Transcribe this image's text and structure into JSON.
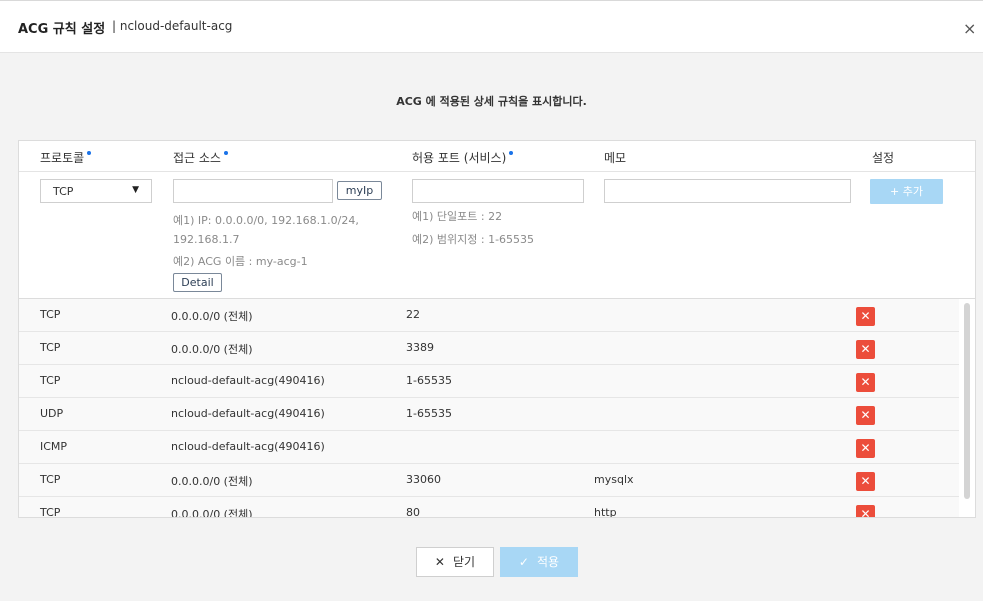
{
  "dialog": {
    "title": "ACG 규칙 설정",
    "subtitle": "| ncloud-default-acg",
    "close_glyph": "×",
    "description": "ACG 에 적용된 상세 규칙을 표시합니다."
  },
  "table": {
    "headers": {
      "protocol": "프로토콜",
      "source": "접근 소스",
      "port": "허용 포트 (서비스)",
      "memo": "메모",
      "setting": "설정"
    },
    "required_color": "#1a73e8"
  },
  "form": {
    "protocol_value": "TCP",
    "source_value": "",
    "port_value": "",
    "memo_value": "",
    "myip_label": "myIp",
    "source_hint1": "예1) IP: 0.0.0.0/0, 192.168.1.0/24,",
    "source_hint1b": "192.168.1.7",
    "source_hint2": "예2) ACG 이름 : my-acg-1",
    "detail_label": "Detail",
    "port_hint1": "예1) 단일포트 : 22",
    "port_hint2": "예2) 범위지정 : 1-65535",
    "add_label": "+ 추가",
    "add_color": "#a8d7f5"
  },
  "rules": [
    {
      "protocol": "TCP",
      "source": "0.0.0.0/0 (전체)",
      "port": "22",
      "memo": ""
    },
    {
      "protocol": "TCP",
      "source": "0.0.0.0/0 (전체)",
      "port": "3389",
      "memo": ""
    },
    {
      "protocol": "TCP",
      "source": "ncloud-default-acg(490416)",
      "port": "1-65535",
      "memo": ""
    },
    {
      "protocol": "UDP",
      "source": "ncloud-default-acg(490416)",
      "port": "1-65535",
      "memo": ""
    },
    {
      "protocol": "ICMP",
      "source": "ncloud-default-acg(490416)",
      "port": "",
      "memo": ""
    },
    {
      "protocol": "TCP",
      "source": "0.0.0.0/0 (전체)",
      "port": "33060",
      "memo": "mysqlx"
    },
    {
      "protocol": "TCP",
      "source": "0.0.0.0/0 (전체)",
      "port": "80",
      "memo": "http"
    }
  ],
  "delete_glyph": "✕",
  "delete_color": "#ec4d3b",
  "footer": {
    "close_label": "닫기",
    "apply_label": "적용",
    "close_icon": "close-icon",
    "apply_icon": "check-icon"
  }
}
